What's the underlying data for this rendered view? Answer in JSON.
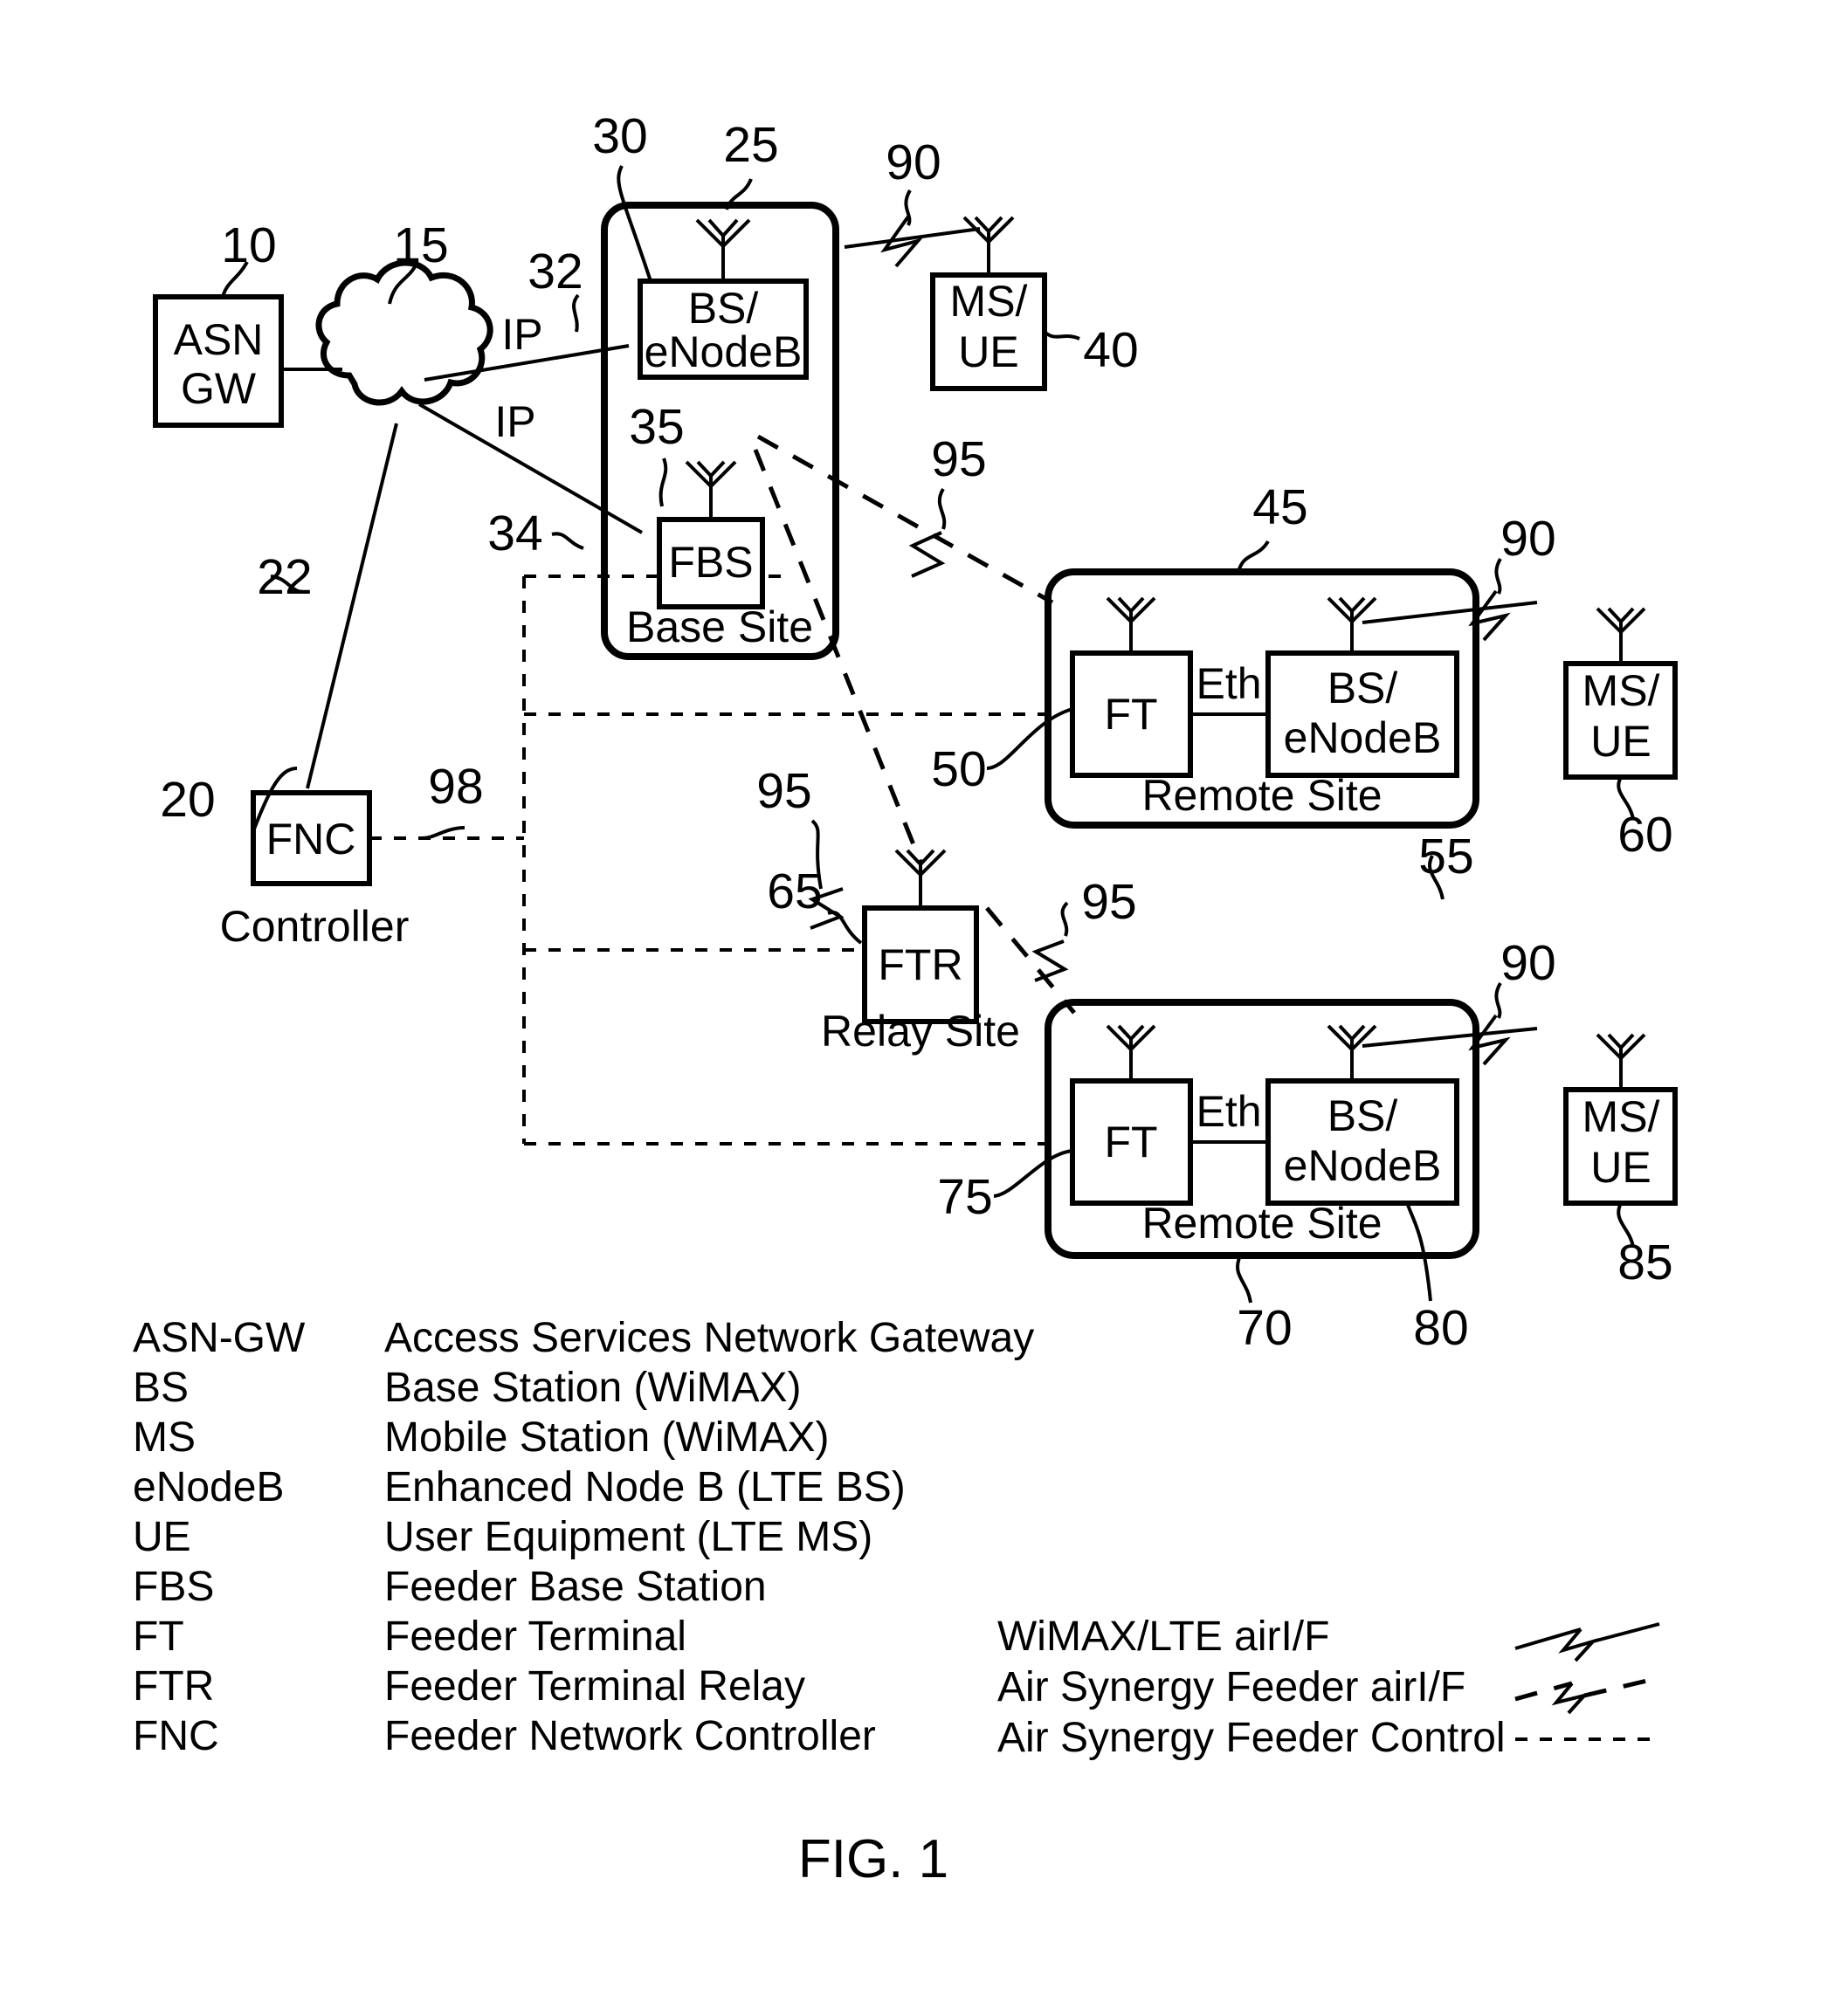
{
  "figure": {
    "caption": "FIG. 1"
  },
  "nodes": {
    "asn_gw": {
      "line1": "ASN",
      "line2": "GW",
      "ref": "10"
    },
    "cloud": {
      "ref": "15"
    },
    "fnc": {
      "label": "FNC",
      "ref": "20",
      "caption": "Controller"
    },
    "base_site": {
      "caption": "Base Site",
      "ref": "30"
    },
    "base_bs": {
      "line1": "BS/",
      "line2": "eNodeB",
      "ref": "25"
    },
    "base_fbs": {
      "label": "FBS",
      "ref": "35"
    },
    "ms_ue_top": {
      "line1": "MS/",
      "line2": "UE",
      "ref": "40"
    },
    "remote_site_1": {
      "caption": "Remote Site",
      "ref": "45"
    },
    "remote1_ft": {
      "label": "FT",
      "ref": "50"
    },
    "remote1_bs": {
      "line1": "BS/",
      "line2": "eNodeB",
      "ref": "55"
    },
    "ms_ue_mid": {
      "line1": "MS/",
      "line2": "UE",
      "ref": "60"
    },
    "relay_site": {
      "caption": "Relay Site"
    },
    "ftr": {
      "label": "FTR",
      "ref": "65"
    },
    "remote_site_2": {
      "caption": "Remote Site",
      "ref": "70"
    },
    "remote2_ft": {
      "label": "FT",
      "ref": "75"
    },
    "remote2_bs": {
      "line1": "BS/",
      "line2": "eNodeB",
      "ref": "80"
    },
    "ms_ue_bot": {
      "line1": "MS/",
      "line2": "UE",
      "ref": "85"
    }
  },
  "links": {
    "ip_upper": {
      "label": "IP",
      "ref": "32"
    },
    "ip_lower": {
      "label": "IP",
      "ref": "34"
    },
    "ctrl_to_cloud": {
      "ref": "22"
    },
    "ctrl_bus": {
      "ref": "98"
    },
    "eth_1": {
      "label": "Eth"
    },
    "eth_2": {
      "label": "Eth"
    },
    "air_90_a": {
      "ref": "90"
    },
    "air_90_b": {
      "ref": "90"
    },
    "air_90_c": {
      "ref": "90"
    },
    "feeder_95_a": {
      "ref": "95"
    },
    "feeder_95_b": {
      "ref": "95"
    },
    "feeder_95_c": {
      "ref": "95"
    }
  },
  "abbreviations": [
    {
      "abbr": "ASN-GW",
      "meaning": "Access Services Network Gateway"
    },
    {
      "abbr": "BS",
      "meaning": "Base Station (WiMAX)"
    },
    {
      "abbr": "MS",
      "meaning": "Mobile Station (WiMAX)"
    },
    {
      "abbr": "eNodeB",
      "meaning": "Enhanced Node B (LTE BS)"
    },
    {
      "abbr": "UE",
      "meaning": "User Equipment (LTE MS)"
    },
    {
      "abbr": "FBS",
      "meaning": "Feeder Base Station"
    },
    {
      "abbr": "FT",
      "meaning": "Feeder Terminal"
    },
    {
      "abbr": "FTR",
      "meaning": "Feeder Terminal Relay"
    },
    {
      "abbr": "FNC",
      "meaning": "Feeder Network Controller"
    }
  ],
  "line_legend": [
    {
      "label": "WiMAX/LTE airI/F",
      "style": "solid-bolt"
    },
    {
      "label": "Air Synergy Feeder airI/F",
      "style": "dashed-bolt"
    },
    {
      "label": "Air Synergy Feeder Control",
      "style": "dotted"
    }
  ]
}
